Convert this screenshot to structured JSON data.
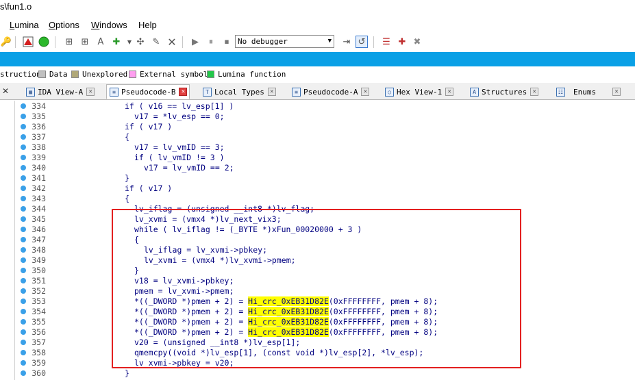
{
  "window": {
    "title": "s\\fun1.o"
  },
  "menu": [
    {
      "label": "Lumina",
      "ul": "L",
      "rest": "umina"
    },
    {
      "label": "Options",
      "ul": "O",
      "rest": "ptions"
    },
    {
      "label": "Windows",
      "ul": "W",
      "rest": "indows"
    },
    {
      "label": "Help",
      "ul": "",
      "rest": "Help"
    }
  ],
  "toolbar": {
    "debugger_value": "No debugger"
  },
  "legend": [
    {
      "label": "struction",
      "color": ""
    },
    {
      "label": "Data",
      "color": "#c0c0c0"
    },
    {
      "label": "Unexplored",
      "color": "#b0a878"
    },
    {
      "label": "External symbol",
      "color": "#ff9ef0"
    },
    {
      "label": "Lumina function",
      "color": "#22c84a"
    }
  ],
  "tabs": [
    {
      "label": "IDA View-A"
    },
    {
      "label": "Pseudocode-B"
    },
    {
      "label": "Local Types"
    },
    {
      "label": "Pseudocode-A"
    },
    {
      "label": "Hex View-1"
    },
    {
      "label": "Structures"
    },
    {
      "label": "Enums"
    }
  ],
  "code_lines": [
    {
      "n": "334",
      "indent": 0,
      "text": "if ( v16 == lv_esp[1] )"
    },
    {
      "n": "335",
      "indent": 1,
      "text": "v17 = *lv_esp == 0;"
    },
    {
      "n": "336",
      "indent": 0,
      "text": "if ( v17 )"
    },
    {
      "n": "337",
      "indent": 0,
      "text": "{"
    },
    {
      "n": "338",
      "indent": 1,
      "text": "v17 = lv_vmID == 3;"
    },
    {
      "n": "339",
      "indent": 1,
      "text": "if ( lv_vmID != 3 )"
    },
    {
      "n": "340",
      "indent": 2,
      "text": "v17 = lv_vmID == 2;"
    },
    {
      "n": "341",
      "indent": 0,
      "text": "}"
    },
    {
      "n": "342",
      "indent": 0,
      "text": "if ( v17 )"
    },
    {
      "n": "343",
      "indent": 0,
      "text": "{"
    },
    {
      "n": "344",
      "indent": 1,
      "text": "lv_iflag = (unsigned __int8 *)lv_flag;"
    },
    {
      "n": "345",
      "indent": 1,
      "text": "lv_xvmi = (vmx4 *)lv_next_vix3;"
    },
    {
      "n": "346",
      "indent": 1,
      "text": "while ( lv_iflag != (_BYTE *)xFun_00020000 + 3 )"
    },
    {
      "n": "347",
      "indent": 1,
      "text": "{"
    },
    {
      "n": "348",
      "indent": 2,
      "text": "lv_iflag = lv_xvmi->pbkey;"
    },
    {
      "n": "349",
      "indent": 2,
      "text": "lv_xvmi = (vmx4 *)lv_xvmi->pmem;"
    },
    {
      "n": "350",
      "indent": 1,
      "text": "}"
    },
    {
      "n": "351",
      "indent": 1,
      "text": "v18 = lv_xvmi->pbkey;"
    },
    {
      "n": "352",
      "indent": 1,
      "text": "pmem = lv_xvmi->pmem;"
    },
    {
      "n": "353",
      "indent": 1,
      "pre": "*((_DWORD *)pmem + 2) = ",
      "hl": "Hi_crc_0xEB31D82E",
      "post": "(0xFFFFFFFF, pmem + 8);"
    },
    {
      "n": "354",
      "indent": 1,
      "pre": "*((_DWORD *)pmem + 2) = ",
      "hl": "Hi_crc_0xEB31D82E",
      "post": "(0xFFFFFFFF, pmem + 8);"
    },
    {
      "n": "355",
      "indent": 1,
      "pre": "*((_DWORD *)pmem + 2) = ",
      "hl": "Hi_crc_0xEB31D82E",
      "post": "(0xFFFFFFFF, pmem + 8);"
    },
    {
      "n": "356",
      "indent": 1,
      "pre": "*((_DWORD *)pmem + 2) = ",
      "hl": "Hi_crc_0xEB31D82E",
      "post": "(0xFFFFFFFF, pmem + 8);"
    },
    {
      "n": "357",
      "indent": 1,
      "text": "v20 = (unsigned __int8 *)lv_esp[1];"
    },
    {
      "n": "358",
      "indent": 1,
      "text": "qmemcpy((void *)lv_esp[1], (const void *)lv_esp[2], *lv_esp);"
    },
    {
      "n": "359",
      "indent": 1,
      "text": "lv_xvmi->pbkey = v20;"
    },
    {
      "n": "360",
      "indent": 0,
      "text": "}"
    }
  ],
  "colors": {
    "nav_band": "#0aa0e6",
    "highlight": "#ffff00",
    "annotation_box": "#e32020",
    "breakpoint_dot": "#3aa0e8"
  }
}
